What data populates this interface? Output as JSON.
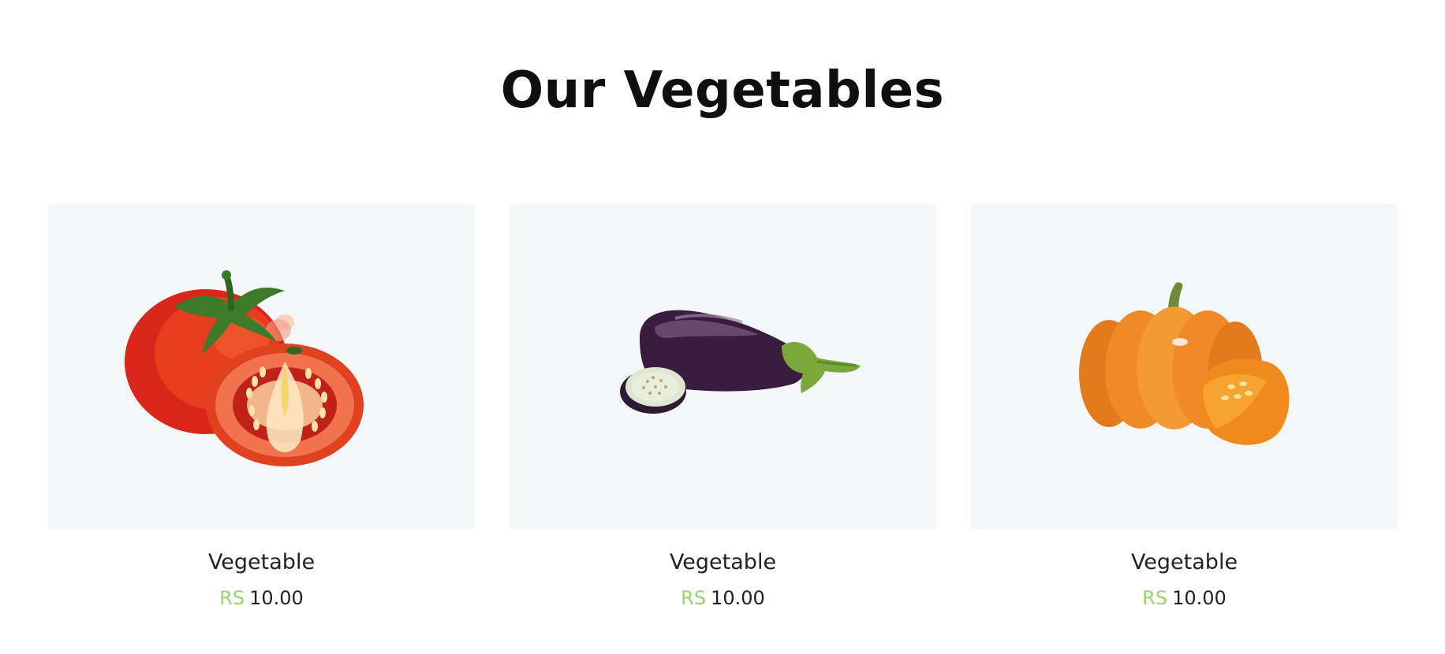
{
  "section": {
    "title": "Our Vegetables"
  },
  "products": [
    {
      "name": "Vegetable",
      "currency": "RS",
      "price": "10.00",
      "image_icon": "tomato-icon"
    },
    {
      "name": "Vegetable",
      "currency": "RS",
      "price": "10.00",
      "image_icon": "eggplant-icon"
    },
    {
      "name": "Vegetable",
      "currency": "RS",
      "price": "10.00",
      "image_icon": "pumpkin-icon"
    }
  ]
}
